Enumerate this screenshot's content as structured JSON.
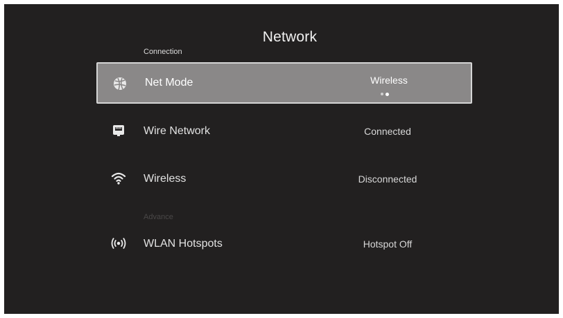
{
  "page": {
    "title": "Network"
  },
  "sections": {
    "connection_label": "Connection",
    "advance_label": "Advance"
  },
  "items": [
    {
      "label": "Net Mode",
      "value": "Wireless",
      "icon": "globe-icon",
      "focused": true,
      "option_dots": 2,
      "active_dot": 2
    },
    {
      "label": "Wire Network",
      "value": "Connected",
      "icon": "ethernet-icon"
    },
    {
      "label": "Wireless",
      "value": "Disconnected",
      "icon": "wifi-icon"
    },
    {
      "label": "WLAN Hotspots",
      "value": "Hotspot Off",
      "icon": "hotspot-icon"
    }
  ],
  "colors": {
    "background": "#222020",
    "focus_fill": "#8a8888",
    "focus_border": "#d6d6d6",
    "text": "#e2e2e2",
    "dim_text": "#4a4848"
  }
}
